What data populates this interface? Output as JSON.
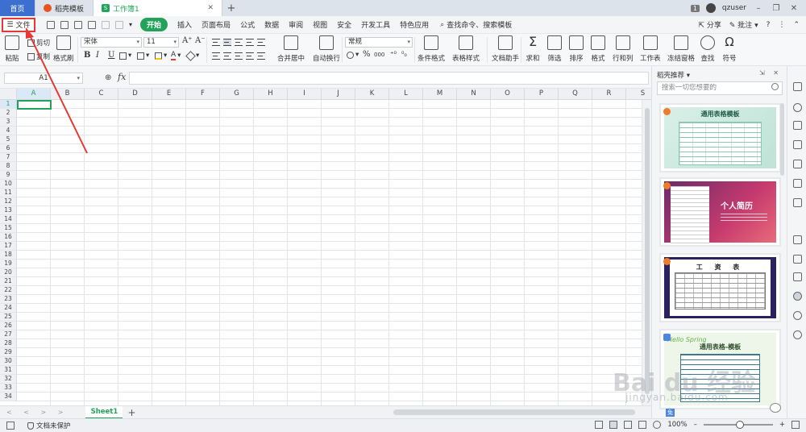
{
  "tabs": {
    "home": "首页",
    "docer": "稻壳模板",
    "workbook": "工作簿1",
    "workbook_icon": "S",
    "new_tab": "+",
    "page_badge": "1",
    "user": "qzuser"
  },
  "menu": {
    "file": "文件",
    "start": "开始",
    "items": [
      "插入",
      "页面布局",
      "公式",
      "数据",
      "审阅",
      "视图",
      "安全",
      "开发工具",
      "特色应用"
    ],
    "search": "查找命令、搜索模板",
    "share": "分享",
    "comment": "批注"
  },
  "ribbon": {
    "paste": "粘贴",
    "cut": "剪切",
    "copy": "复制",
    "format_painter": "格式刷",
    "font_name": "宋体",
    "font_size": "11",
    "bold": "B",
    "italic": "I",
    "underline": "U",
    "merge_center": "合并居中",
    "wrap_text": "自动换行",
    "number_format": "常规",
    "percent": "%",
    "thousands": "000",
    "cond_format": "条件格式",
    "table_style": "表格样式",
    "doc_helper": "文档助手",
    "sum": "求和",
    "filter": "筛选",
    "sort": "排序",
    "format": "格式",
    "row_col": "行和列",
    "worksheet": "工作表",
    "freeze": "冻结窗格",
    "find": "查找",
    "symbol": "符号"
  },
  "formula_bar": {
    "cell_ref": "A1",
    "fx": "fx",
    "value": ""
  },
  "grid": {
    "columns": [
      "A",
      "B",
      "C",
      "D",
      "E",
      "F",
      "G",
      "H",
      "I",
      "J",
      "K",
      "L",
      "M",
      "N",
      "O",
      "P",
      "Q",
      "R",
      "S"
    ],
    "rows": [
      "1",
      "2",
      "3",
      "4",
      "5",
      "6",
      "7",
      "8",
      "9",
      "10",
      "11",
      "12",
      "13",
      "14",
      "15",
      "16",
      "17",
      "18",
      "19",
      "20",
      "21",
      "22",
      "23",
      "24",
      "25",
      "26",
      "27",
      "28",
      "29",
      "30",
      "31",
      "32",
      "33",
      "34"
    ],
    "selected_cell": "A1"
  },
  "sheets": {
    "active": "Sheet1",
    "add": "+"
  },
  "status": {
    "protection": "文档未保护",
    "zoom": "100%"
  },
  "panel": {
    "title": "稻壳推荐",
    "search_placeholder": "搜索一切您想要的",
    "cards": [
      {
        "title": "通用表格模板"
      },
      {
        "title": "个人简历"
      },
      {
        "title": "工 资 表"
      },
      {
        "title": "通用表格-模板",
        "deco": "Hello Spring",
        "badge": "免"
      }
    ]
  },
  "watermark": {
    "main": "Bai du 经验",
    "sub": "jingyan.baidu.com"
  },
  "colors": {
    "accent_green": "#23a35a",
    "highlight_red": "#e53935",
    "home_blue": "#3c6fcf"
  }
}
